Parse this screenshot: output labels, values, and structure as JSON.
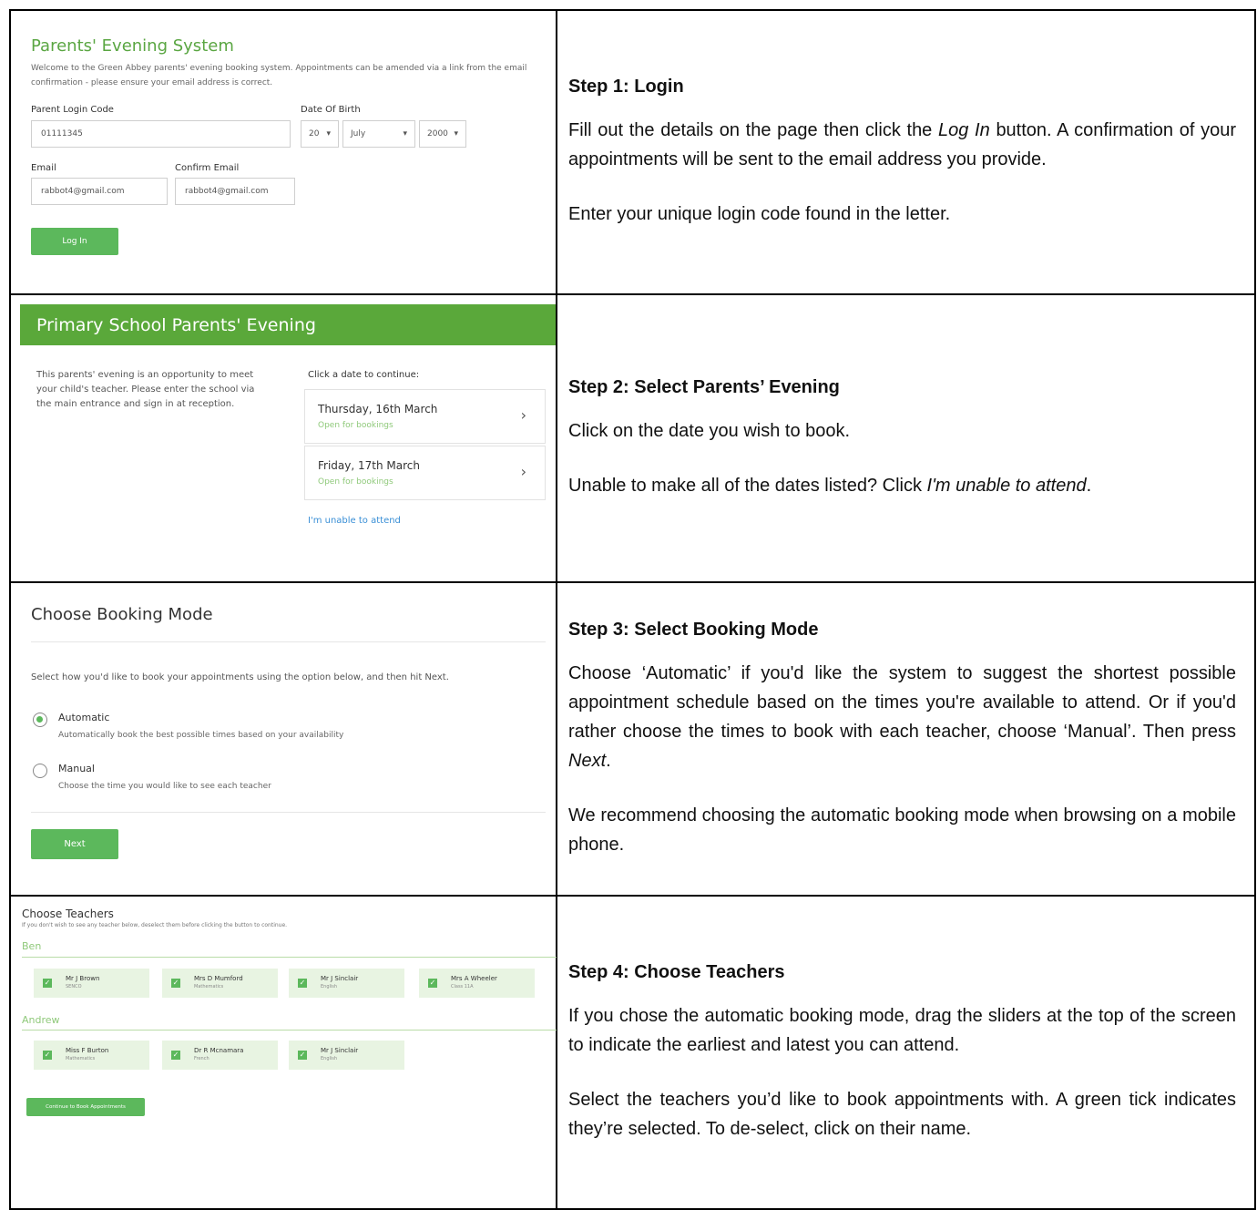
{
  "step1": {
    "shot": {
      "title": "Parents' Evening System",
      "intro": "Welcome to the Green Abbey parents' evening booking system. Appointments can be amended via a link from the email confirmation - please ensure your email address is correct.",
      "login_code_label": "Parent Login Code",
      "login_code_value": "01111345",
      "dob_label": "Date Of Birth",
      "dob_day": "20",
      "dob_month": "July",
      "dob_year": "2000",
      "email_label": "Email",
      "email_value": "rabbot4@gmail.com",
      "confirm_email_label": "Confirm Email",
      "confirm_email_value": "rabbot4@gmail.com",
      "login_button": "Log In"
    },
    "heading": "Step 1: Login",
    "text_a": "Fill out the details on the page then click the ",
    "text_em": "Log In",
    "text_b": " button. A confirmation of your appointments will be sent to the email address you provide.",
    "text2": "Enter your unique login code found in the letter."
  },
  "step2": {
    "shot": {
      "banner": "Primary School Parents' Evening",
      "intro": "This parents' evening is an opportunity to meet your child's teacher. Please enter the school via the main entrance and sign in at reception.",
      "click_label": "Click a date to continue:",
      "dates": [
        {
          "date": "Thursday, 16th March",
          "status": "Open for bookings"
        },
        {
          "date": "Friday, 17th March",
          "status": "Open for bookings"
        }
      ],
      "unable_link": "I'm unable to attend"
    },
    "heading": "Step 2: Select Parents’ Evening",
    "text1": "Click on the date you wish to book.",
    "text2_a": "Unable to make all of the dates listed? Click ",
    "text2_em": "I'm unable to attend",
    "text2_b": "."
  },
  "step3": {
    "shot": {
      "title": "Choose Booking Mode",
      "intro": "Select how you'd like to book your appointments using the option below, and then hit Next.",
      "options": [
        {
          "label": "Automatic",
          "desc": "Automatically book the best possible times based on your availability",
          "selected": true
        },
        {
          "label": "Manual",
          "desc": "Choose the time you would like to see each teacher",
          "selected": false
        }
      ],
      "next_button": "Next"
    },
    "heading": "Step 3: Select Booking Mode",
    "text_a": "Choose ‘Automatic’ if you'd like the system to suggest the shortest possible appointment schedule based on the times you're available to attend. Or if you'd rather choose the times to book with each teacher, choose ‘Manual’. Then press ",
    "text_em": "Next",
    "text_b": ".",
    "text2": "We recommend choosing the automatic booking mode when browsing on a mobile phone."
  },
  "step4": {
    "shot": {
      "title": "Choose Teachers",
      "subtitle": "If you don't wish to see any teacher below, deselect them before clicking the button to continue.",
      "children": [
        {
          "name": "Ben",
          "teachers": [
            {
              "name": "Mr J Brown",
              "subject": "SENCO"
            },
            {
              "name": "Mrs D Mumford",
              "subject": "Mathematics"
            },
            {
              "name": "Mr J Sinclair",
              "subject": "English"
            },
            {
              "name": "Mrs A Wheeler",
              "subject": "Class 11A"
            }
          ]
        },
        {
          "name": "Andrew",
          "teachers": [
            {
              "name": "Miss F Burton",
              "subject": "Mathematics"
            },
            {
              "name": "Dr R Mcnamara",
              "subject": "French"
            },
            {
              "name": "Mr J Sinclair",
              "subject": "English"
            }
          ]
        }
      ],
      "continue_button": "Continue to Book Appointments"
    },
    "heading": "Step 4: Choose Teachers",
    "text1": "If you chose the automatic booking mode, drag the sliders at the top of the screen to indicate the earliest and latest you can attend.",
    "text2": "Select the teachers you’d like to book appointments with. A green tick indicates they’re selected. To de-select, click on their name."
  },
  "colors": {
    "brand_green": "#5aa83a",
    "button_green": "#5cb85c",
    "link_blue": "#3a8fd6"
  }
}
